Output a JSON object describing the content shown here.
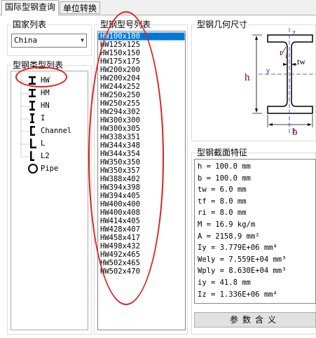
{
  "tabs": [
    {
      "label": "国际型钢查询"
    },
    {
      "label": "单位转换"
    }
  ],
  "country": {
    "group_label": "国家列表",
    "selected": "China"
  },
  "type_tree": {
    "group_label": "型钢类型列表",
    "items": [
      {
        "label": "HW",
        "icon": "i-beam-icon"
      },
      {
        "label": "HM",
        "icon": "i-beam-icon"
      },
      {
        "label": "HN",
        "icon": "i-beam-icon"
      },
      {
        "label": "I",
        "icon": "i-beam-icon"
      },
      {
        "label": "Channel",
        "icon": "channel-icon"
      },
      {
        "label": "L",
        "icon": "angle-icon"
      },
      {
        "label": "L2",
        "icon": "angle-icon"
      },
      {
        "label": "Pipe",
        "icon": "pipe-icon"
      }
    ]
  },
  "model_list": {
    "group_label": "型钢型号列表",
    "selected_index": 0,
    "items": [
      "HW100x100",
      "HW125x125",
      "HW150x150",
      "HW175x175",
      "HW200x200",
      "HW200x204",
      "HW244x252",
      "HW250x250",
      "HW250x255",
      "HW294x302",
      "HW300x300",
      "HW300x305",
      "HW338x351",
      "HW344x348",
      "HW344x354",
      "HW350x350",
      "HW350x357",
      "HW388x402",
      "HW394x398",
      "HW394x405",
      "HW400x400",
      "HW400x408",
      "HW414x405",
      "HW428x407",
      "HW458x417",
      "HW498x432",
      "HW492x465",
      "HW502x465",
      "HW502x470"
    ]
  },
  "geometry": {
    "group_label": "型钢几何尺寸",
    "labels": {
      "h": "h",
      "b": "b",
      "tw": "tw",
      "r": "r",
      "ri": "i",
      "y": "y",
      "z": "z"
    },
    "colors": {
      "dim": "#8b0000",
      "axis": "#3030c0",
      "shape": "#000000"
    }
  },
  "section": {
    "group_label": "型钢截面特征",
    "rows": [
      "h = 100.0 mm",
      "b = 100.0 mm",
      "tw = 6.0 mm",
      "tf = 8.0 mm",
      "ri = 8.0 mm",
      "M = 16.9 kg/m",
      "A = 2158.9 mm²",
      "Iy = 3.779E+06 mm⁴",
      "Wely = 7.559E+04 mm³",
      "Wply = 8.630E+04 mm³",
      "iy = 41.8 mm",
      "Iz = 1.336E+06 mm⁴"
    ],
    "button_label": "参数含义"
  }
}
